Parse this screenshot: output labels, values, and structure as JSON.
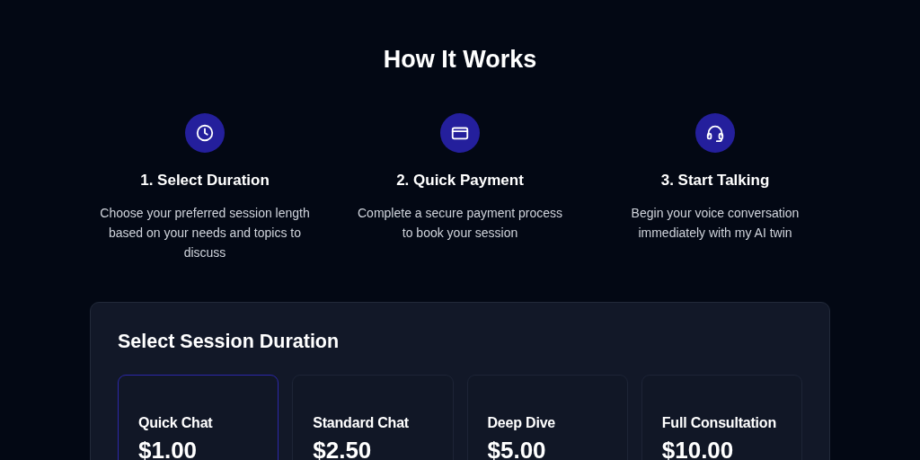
{
  "heading": "How It Works",
  "steps": [
    {
      "kind": "clock",
      "title": "1. Select Duration",
      "text": "Choose your preferred session length based on your needs and topics to discuss"
    },
    {
      "kind": "card",
      "title": "2. Quick Payment",
      "text": "Complete a secure payment process to book your session"
    },
    {
      "kind": "headset",
      "title": "3. Start Talking",
      "text": "Begin your voice conversation immediately with my AI twin"
    }
  ],
  "duration_panel": {
    "title": "Select Session Duration",
    "options": [
      {
        "name": "Quick Chat",
        "price": "$1.00",
        "selected": true
      },
      {
        "name": "Standard Chat",
        "price": "$2.50",
        "selected": false
      },
      {
        "name": "Deep Dive",
        "price": "$5.00",
        "selected": false
      },
      {
        "name": "Full Consultation",
        "price": "$10.00",
        "selected": false
      }
    ]
  }
}
